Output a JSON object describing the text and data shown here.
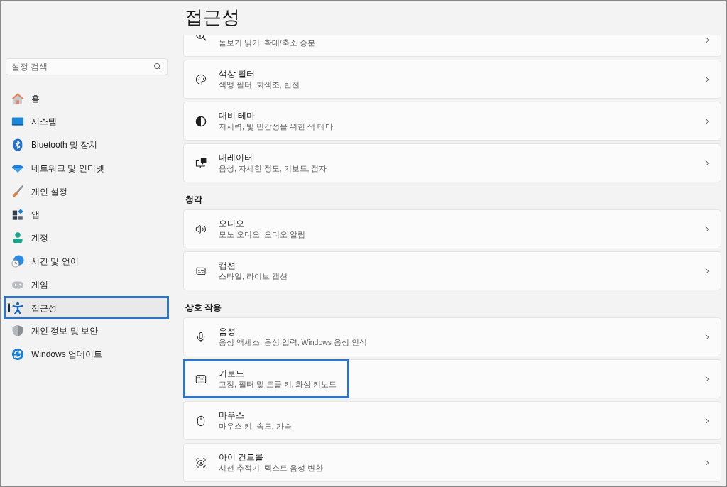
{
  "sidebar": {
    "search": {
      "placeholder": "설정 검색"
    },
    "items": [
      {
        "label": "홈",
        "selected": false,
        "highlighted": false
      },
      {
        "label": "시스템",
        "selected": false,
        "highlighted": false
      },
      {
        "label": "Bluetooth 및 장치",
        "selected": false,
        "highlighted": false
      },
      {
        "label": "네트워크 및 인터넷",
        "selected": false,
        "highlighted": false
      },
      {
        "label": "개인 설정",
        "selected": false,
        "highlighted": false
      },
      {
        "label": "앱",
        "selected": false,
        "highlighted": false
      },
      {
        "label": "계정",
        "selected": false,
        "highlighted": false
      },
      {
        "label": "시간 및 언어",
        "selected": false,
        "highlighted": false
      },
      {
        "label": "게임",
        "selected": false,
        "highlighted": false
      },
      {
        "label": "접근성",
        "selected": true,
        "highlighted": true
      },
      {
        "label": "개인 정보 및 보안",
        "selected": false,
        "highlighted": false
      },
      {
        "label": "Windows 업데이트",
        "selected": false,
        "highlighted": false
      }
    ]
  },
  "page": {
    "title": "접근성"
  },
  "sections": [
    {
      "cards": [
        {
          "kind": "clipped",
          "description": "돋보기 읽기, 확대/축소 증분",
          "highlighted": false
        },
        {
          "kind": "full",
          "title": "색상 필터",
          "description": "색맹 필터, 회색조, 반전",
          "highlighted": false
        },
        {
          "kind": "full",
          "title": "대비 테마",
          "description": "저시력, 빛 민감성을 위한 색 테마",
          "highlighted": false
        },
        {
          "kind": "full",
          "title": "내레이터",
          "description": "음성, 자세한 정도, 키보드, 점자",
          "highlighted": false
        }
      ]
    },
    {
      "heading": "청각",
      "cards": [
        {
          "kind": "full",
          "title": "오디오",
          "description": "모노 오디오, 오디오 알림",
          "highlighted": false
        },
        {
          "kind": "full",
          "title": "캡션",
          "description": "스타일, 라이브 캡션",
          "highlighted": false
        }
      ]
    },
    {
      "heading": "상호 작용",
      "cards": [
        {
          "kind": "full",
          "title": "음성",
          "description": "음성 액세스, 음성 입력, Windows 음성 인식",
          "highlighted": false
        },
        {
          "kind": "full",
          "title": "키보드",
          "description": "고정, 필터 및 토글 키, 화상 키보드",
          "highlighted": true
        },
        {
          "kind": "full",
          "title": "마우스",
          "description": "마우스 키, 속도, 가속",
          "highlighted": false
        },
        {
          "kind": "full",
          "title": "아이 컨트롤",
          "description": "시선 추적기, 텍스트 음성 변환",
          "highlighted": false
        }
      ]
    }
  ]
}
